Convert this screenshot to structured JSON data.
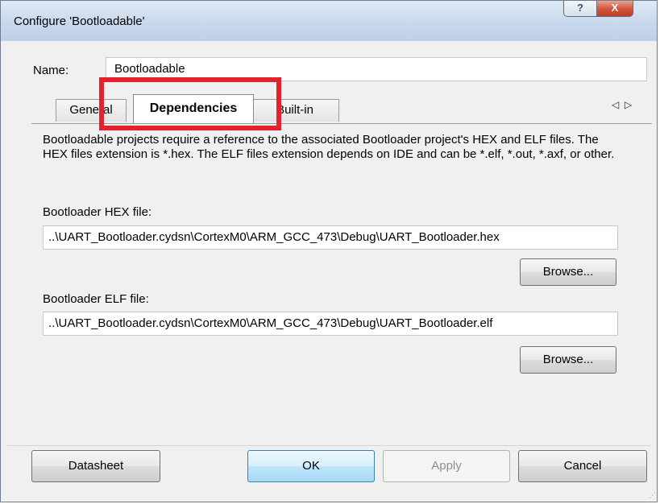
{
  "window": {
    "title": "Configure 'Bootloadable'",
    "help_glyph": "?",
    "close_glyph": "X"
  },
  "name": {
    "label": "Name:",
    "value": "Bootloadable"
  },
  "tabs": [
    {
      "label": "General",
      "active": false
    },
    {
      "label": "Dependencies",
      "active": true
    },
    {
      "label": "Built-in",
      "active": false
    }
  ],
  "tab_scroll": {
    "left": "◁",
    "right": "▷"
  },
  "highlight_color": "#e3222b",
  "description": "Bootloadable projects require a reference to the associated Bootloader project's HEX and ELF files. The HEX files extension is *.hex. The ELF files extension depends on IDE and can be *.elf, *.out, *.axf, or other.",
  "hex": {
    "label": "Bootloader HEX file:",
    "path": "..\\UART_Bootloader.cydsn\\CortexM0\\ARM_GCC_473\\Debug\\UART_Bootloader.hex",
    "browse_label": "Browse..."
  },
  "elf": {
    "label": "Bootloader ELF file:",
    "path": "..\\UART_Bootloader.cydsn\\CortexM0\\ARM_GCC_473\\Debug\\UART_Bootloader.elf",
    "browse_label": "Browse..."
  },
  "buttons": {
    "datasheet": "Datasheet",
    "ok": "OK",
    "apply": "Apply",
    "cancel": "Cancel"
  }
}
